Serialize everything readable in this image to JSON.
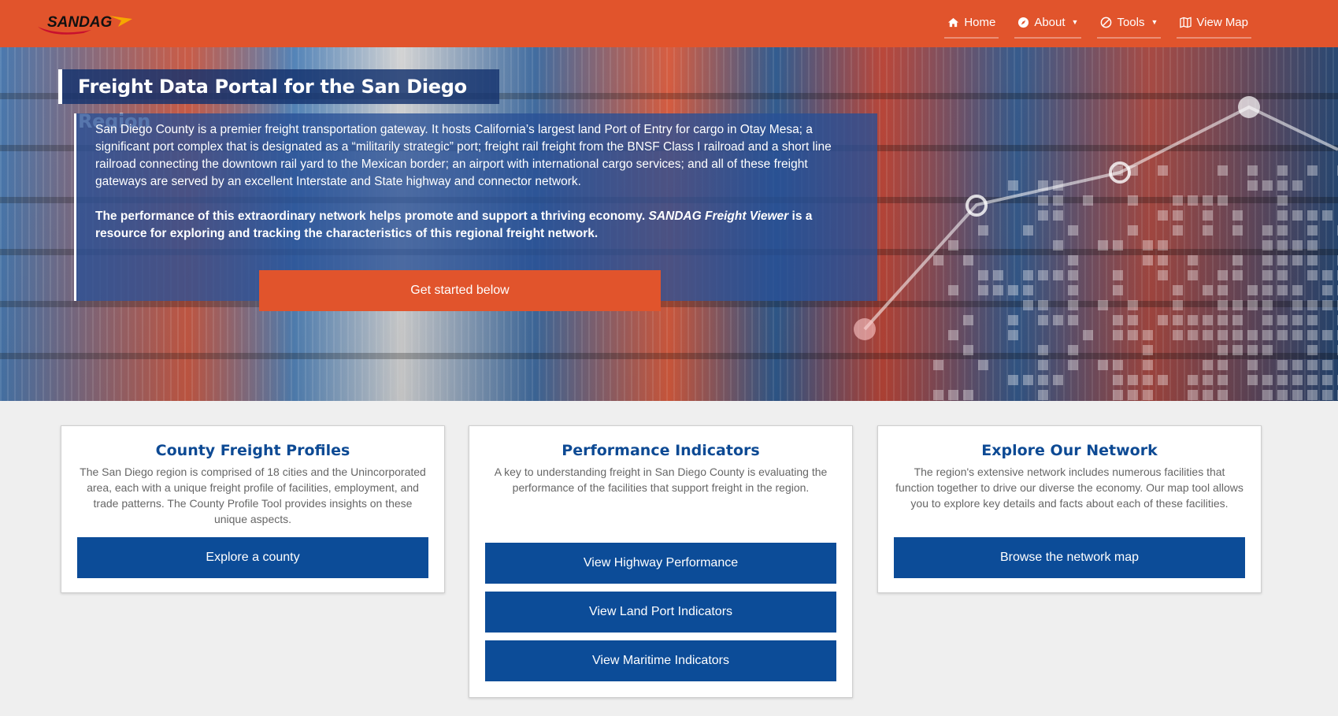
{
  "header": {
    "logo_text": "SANDAG",
    "nav": [
      {
        "label": "Home",
        "icon": "home-icon"
      },
      {
        "label": "About",
        "icon": "compass-icon",
        "dropdown": true
      },
      {
        "label": "Tools",
        "icon": "tools-icon",
        "dropdown": true
      },
      {
        "label": "View Map",
        "icon": "map-icon"
      }
    ]
  },
  "hero": {
    "title": "Freight Data Portal for the San Diego Region",
    "paragraph1": "San Diego County is a premier freight transportation gateway. It hosts California’s largest land Port of Entry for cargo in Otay Mesa; a significant port complex that is designated as a “militarily strategic” port; freight rail freight from the BNSF Class I railroad and a short line railroad connecting the downtown rail yard to the Mexican border; an airport with international cargo services; and all of these freight gateways are served by an excellent Interstate and State highway and connector network.",
    "paragraph2_part1": "The performance of this extraordinary network helps promote and support a thriving economy. ",
    "paragraph2_italic": "SANDAG Freight Viewer",
    "paragraph2_part2": " is a resource for exploring and tracking the characteristics of this regional freight network.",
    "cta_label": "Get started below"
  },
  "cards": [
    {
      "title": "County Freight Profiles",
      "text": "The San Diego region is comprised of 18 cities and the Unincorporated area, each with a unique freight profile of facilities, employment, and trade patterns. The County Profile Tool provides insights on these unique aspects.",
      "buttons": [
        "Explore a county"
      ]
    },
    {
      "title": "Performance Indicators",
      "text": "A key to understanding freight in San Diego County is evaluating the performance of the facilities that support freight in the region.",
      "buttons": [
        "View Highway Performance",
        "View Land Port Indicators",
        "View Maritime Indicators"
      ]
    },
    {
      "title": "Explore Our Network",
      "text": "The region's extensive network includes numerous facilities that function together to drive our diverse the economy. Our map tool allows you to explore key details and facts about each of these facilities.",
      "buttons": [
        "Browse the network map"
      ]
    }
  ],
  "colors": {
    "brand_orange": "#e1542c",
    "brand_blue": "#0c4c98",
    "title_blue": "#0d4a94"
  }
}
